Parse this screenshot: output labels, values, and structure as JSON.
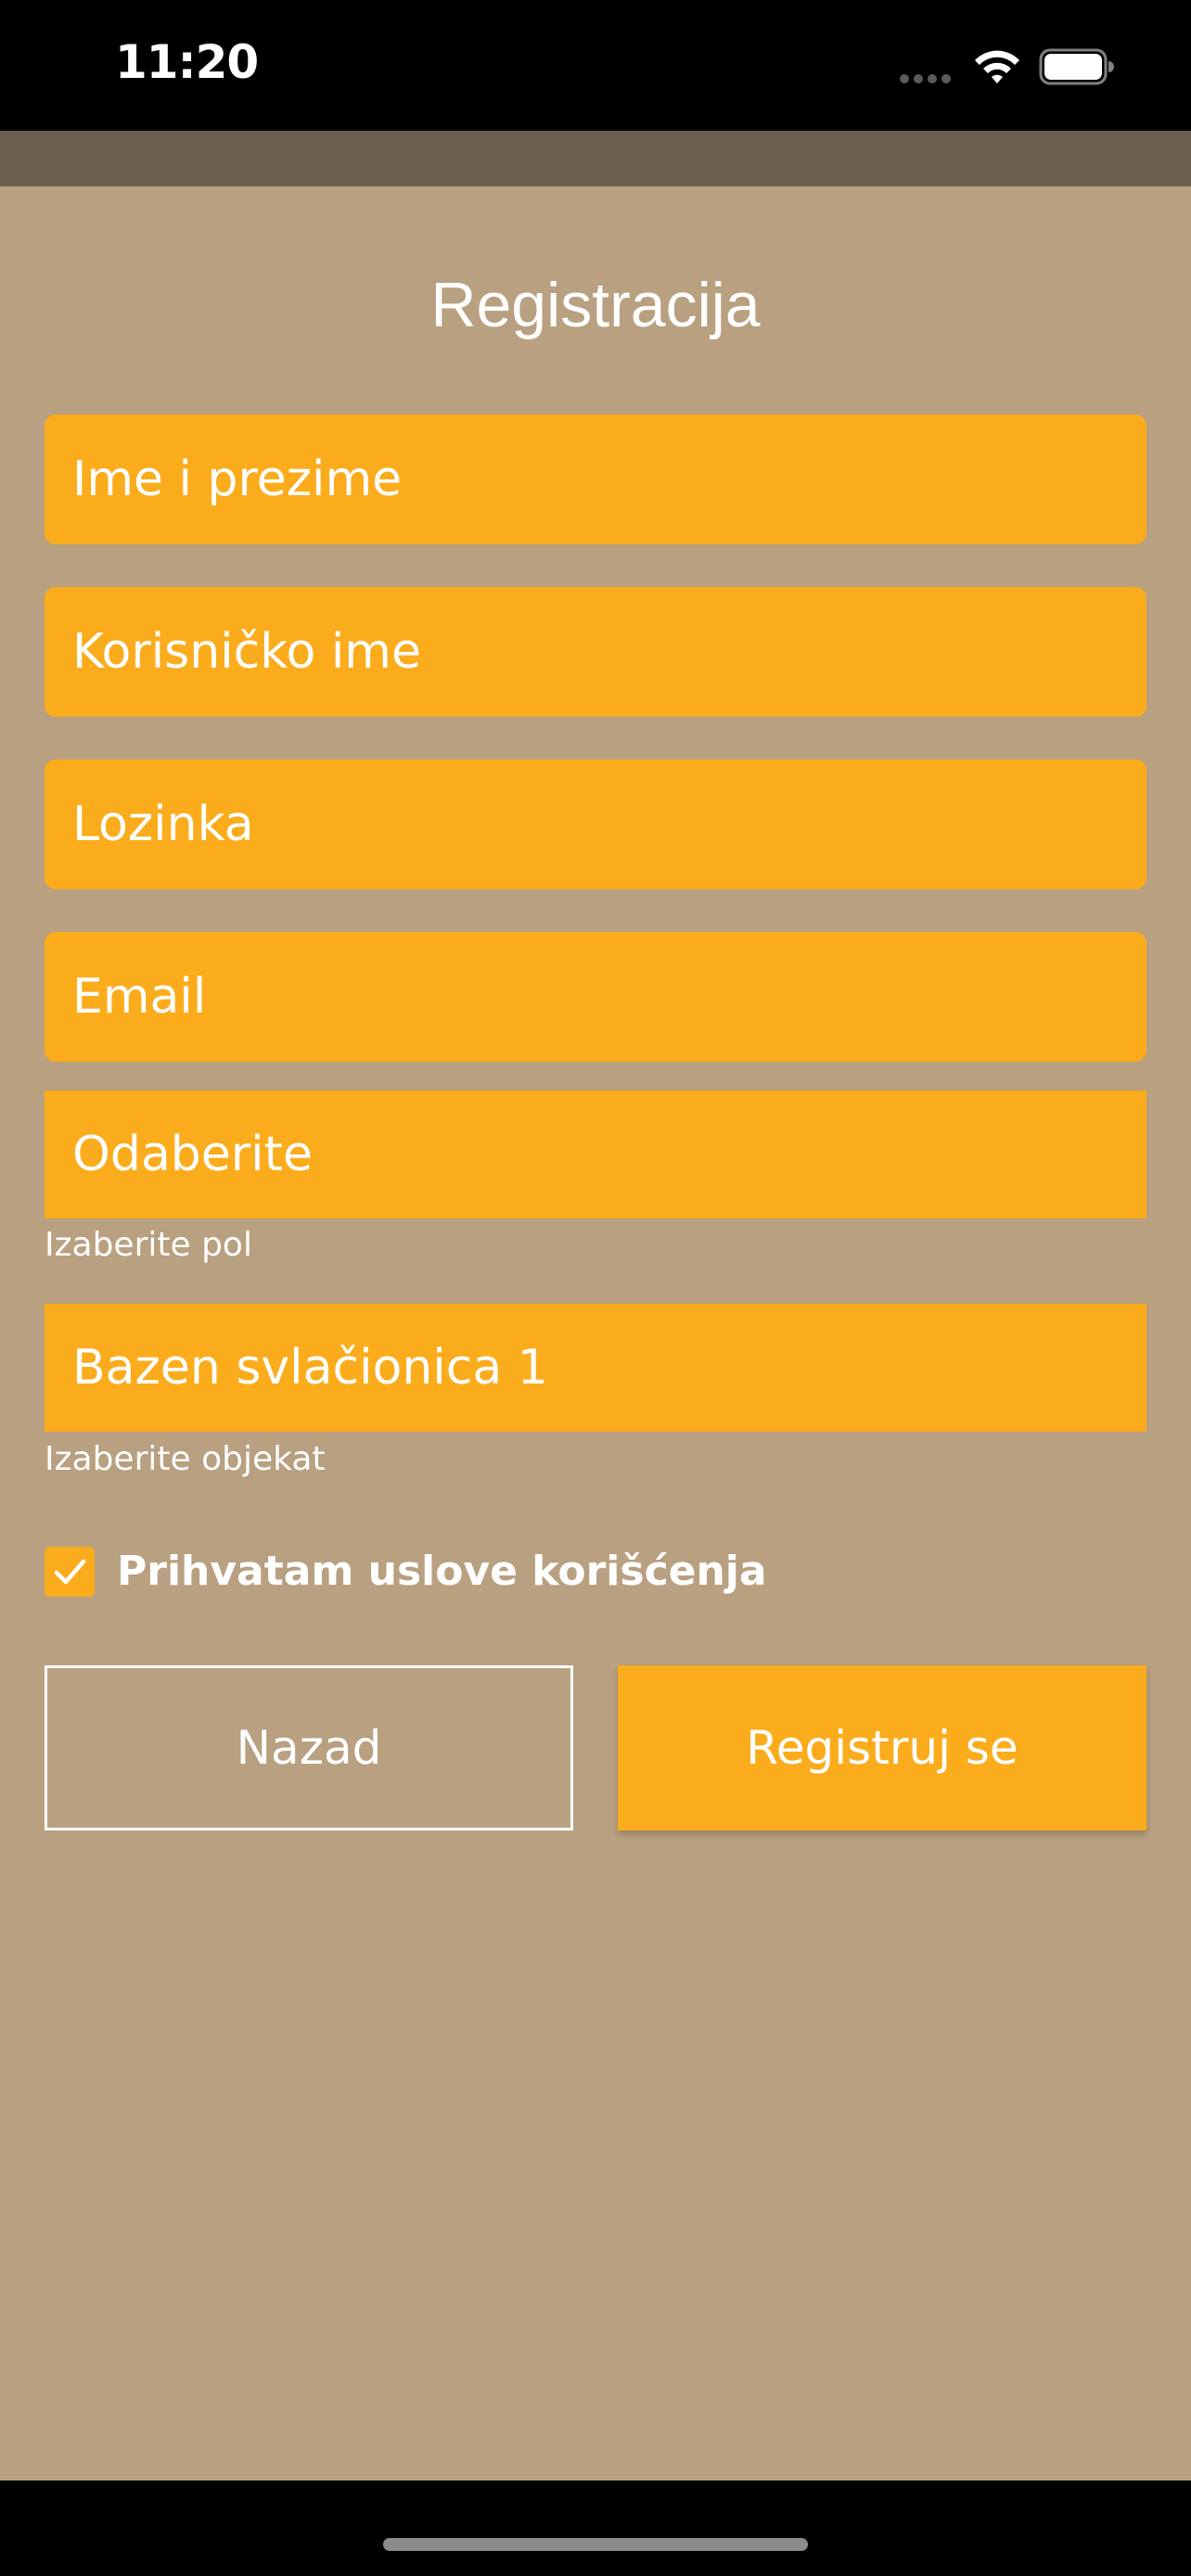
{
  "status_bar": {
    "time": "11:20"
  },
  "page": {
    "title": "Registracija"
  },
  "form": {
    "full_name_placeholder": "Ime i prezime",
    "username_placeholder": "Korisničko ime",
    "password_placeholder": "Lozinka",
    "email_placeholder": "Email",
    "gender_select_value": "Odaberite",
    "gender_helper": "Izaberite pol",
    "facility_select_value": "Bazen svlačionica 1",
    "facility_helper": "Izaberite objekat",
    "terms_label": "Prihvatam uslove korišćenja",
    "terms_checked": true
  },
  "actions": {
    "back_label": "Nazad",
    "register_label": "Registruj se"
  },
  "colors": {
    "background": "#b8a080",
    "accent": "#fbac1c",
    "nav_strip": "#6c5e4c"
  },
  "icons": {
    "wifi": "wifi-icon",
    "battery": "battery-icon",
    "checkmark": "checkmark-icon"
  }
}
